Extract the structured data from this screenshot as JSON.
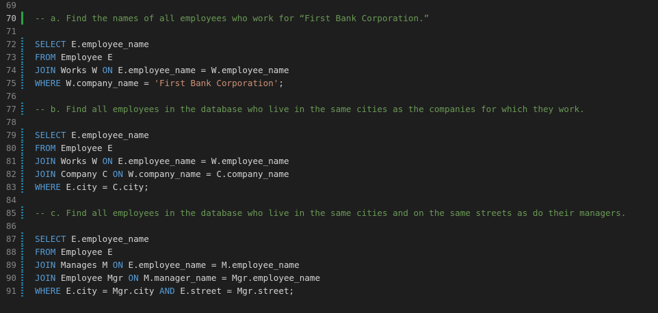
{
  "editor": {
    "lines": [
      {
        "num": "69",
        "active": false,
        "diff": "none",
        "tokens": []
      },
      {
        "num": "70",
        "active": true,
        "diff": "added",
        "tokens": [
          {
            "t": "comment",
            "v": "-- a. Find the names of all employees who work for “First Bank Corporation.”"
          }
        ]
      },
      {
        "num": "71",
        "active": false,
        "diff": "none",
        "tokens": []
      },
      {
        "num": "72",
        "active": false,
        "diff": "modified",
        "tokens": [
          {
            "t": "keyword",
            "v": "SELECT"
          },
          {
            "t": "plain",
            "v": " E.employee_name"
          }
        ]
      },
      {
        "num": "73",
        "active": false,
        "diff": "modified",
        "tokens": [
          {
            "t": "keyword",
            "v": "FROM"
          },
          {
            "t": "plain",
            "v": " Employee E"
          }
        ]
      },
      {
        "num": "74",
        "active": false,
        "diff": "modified",
        "tokens": [
          {
            "t": "keyword",
            "v": "JOIN"
          },
          {
            "t": "plain",
            "v": " Works W "
          },
          {
            "t": "keyword",
            "v": "ON"
          },
          {
            "t": "plain",
            "v": " E.employee_name = W.employee_name"
          }
        ]
      },
      {
        "num": "75",
        "active": false,
        "diff": "modified",
        "tokens": [
          {
            "t": "keyword",
            "v": "WHERE"
          },
          {
            "t": "plain",
            "v": " W.company_name = "
          },
          {
            "t": "string",
            "v": "'First Bank Corporation'"
          },
          {
            "t": "plain",
            "v": ";"
          }
        ]
      },
      {
        "num": "76",
        "active": false,
        "diff": "none",
        "tokens": []
      },
      {
        "num": "77",
        "active": false,
        "diff": "modified",
        "tokens": [
          {
            "t": "comment",
            "v": "-- b. Find all employees in the database who live in the same cities as the companies for which they work."
          }
        ]
      },
      {
        "num": "78",
        "active": false,
        "diff": "none",
        "tokens": []
      },
      {
        "num": "79",
        "active": false,
        "diff": "modified",
        "tokens": [
          {
            "t": "keyword",
            "v": "SELECT"
          },
          {
            "t": "plain",
            "v": " E.employee_name"
          }
        ]
      },
      {
        "num": "80",
        "active": false,
        "diff": "modified",
        "tokens": [
          {
            "t": "keyword",
            "v": "FROM"
          },
          {
            "t": "plain",
            "v": " Employee E"
          }
        ]
      },
      {
        "num": "81",
        "active": false,
        "diff": "modified",
        "tokens": [
          {
            "t": "keyword",
            "v": "JOIN"
          },
          {
            "t": "plain",
            "v": " Works W "
          },
          {
            "t": "keyword",
            "v": "ON"
          },
          {
            "t": "plain",
            "v": " E.employee_name = W.employee_name"
          }
        ]
      },
      {
        "num": "82",
        "active": false,
        "diff": "modified",
        "tokens": [
          {
            "t": "keyword",
            "v": "JOIN"
          },
          {
            "t": "plain",
            "v": " Company C "
          },
          {
            "t": "keyword",
            "v": "ON"
          },
          {
            "t": "plain",
            "v": " W.company_name = C.company_name"
          }
        ]
      },
      {
        "num": "83",
        "active": false,
        "diff": "modified",
        "tokens": [
          {
            "t": "keyword",
            "v": "WHERE"
          },
          {
            "t": "plain",
            "v": " E.city = C.city;"
          }
        ]
      },
      {
        "num": "84",
        "active": false,
        "diff": "none",
        "tokens": []
      },
      {
        "num": "85",
        "active": false,
        "diff": "modified",
        "tokens": [
          {
            "t": "comment",
            "v": "-- c. Find all employees in the database who live in the same cities and on the same streets as do their managers."
          }
        ]
      },
      {
        "num": "86",
        "active": false,
        "diff": "none",
        "tokens": []
      },
      {
        "num": "87",
        "active": false,
        "diff": "modified",
        "tokens": [
          {
            "t": "keyword",
            "v": "SELECT"
          },
          {
            "t": "plain",
            "v": " E.employee_name"
          }
        ]
      },
      {
        "num": "88",
        "active": false,
        "diff": "modified",
        "tokens": [
          {
            "t": "keyword",
            "v": "FROM"
          },
          {
            "t": "plain",
            "v": " Employee E"
          }
        ]
      },
      {
        "num": "89",
        "active": false,
        "diff": "modified",
        "tokens": [
          {
            "t": "keyword",
            "v": "JOIN"
          },
          {
            "t": "plain",
            "v": " Manages M "
          },
          {
            "t": "keyword",
            "v": "ON"
          },
          {
            "t": "plain",
            "v": " E.employee_name = M.employee_name"
          }
        ]
      },
      {
        "num": "90",
        "active": false,
        "diff": "modified",
        "tokens": [
          {
            "t": "keyword",
            "v": "JOIN"
          },
          {
            "t": "plain",
            "v": " Employee Mgr "
          },
          {
            "t": "keyword",
            "v": "ON"
          },
          {
            "t": "plain",
            "v": " M.manager_name = Mgr.employee_name"
          }
        ]
      },
      {
        "num": "91",
        "active": false,
        "diff": "modified",
        "tokens": [
          {
            "t": "keyword",
            "v": "WHERE"
          },
          {
            "t": "plain",
            "v": " E.city = Mgr.city "
          },
          {
            "t": "keyword",
            "v": "AND"
          },
          {
            "t": "plain",
            "v": " E.street = Mgr.street;"
          }
        ]
      }
    ]
  },
  "colors": {
    "background": "#1e1e1e",
    "keyword": "#569cd6",
    "comment": "#6a9955",
    "string": "#ce9178",
    "text": "#d4d4d4",
    "line_number": "#858585",
    "diff_added": "#2ea043",
    "diff_modified": "#1b81a8"
  }
}
